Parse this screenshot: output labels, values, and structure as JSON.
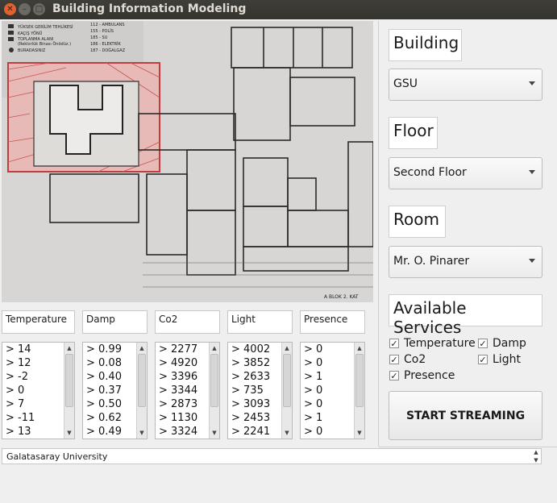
{
  "window": {
    "title": "Building Information Modeling"
  },
  "floorplan": {
    "legend": [
      "YÜKSEK GERİLİM TEHLİKESİ",
      "KAÇIŞ YÖNÜ",
      "TOPLANMA ALANI",
      "(Reklorlük Binası Önödüz.)",
      "BURADASINIZ"
    ],
    "emergency": [
      "112 - AMBULANS",
      "155 - POLİS",
      "185 - SU",
      "186 - ELEKTRİK",
      "187 - DOĞALGAZ"
    ],
    "caption": "A BLOK 2. KAT"
  },
  "sensors": [
    {
      "label": "Temperature",
      "values": [
        "> 14",
        "> 12",
        "> -2",
        "> 0",
        "> 7",
        "> -11",
        "> 13"
      ]
    },
    {
      "label": "Damp",
      "values": [
        "> 0.99",
        "> 0.08",
        "> 0.40",
        "> 0.37",
        "> 0.50",
        "> 0.62",
        "> 0.49"
      ]
    },
    {
      "label": "Co2",
      "values": [
        "> 2277",
        "> 4920",
        "> 3396",
        "> 3344",
        "> 2873",
        "> 1130",
        "> 3324"
      ]
    },
    {
      "label": "Light",
      "values": [
        "> 4002",
        "> 3852",
        "> 2633",
        "> 735",
        "> 3093",
        "> 2453",
        "> 2241"
      ]
    },
    {
      "label": "Presence",
      "values": [
        "> 0",
        "> 0",
        "> 1",
        "> 0",
        "> 0",
        "> 1",
        "> 0"
      ]
    }
  ],
  "panel": {
    "building_label": "Building",
    "building_value": "GSU",
    "floor_label": "Floor",
    "floor_value": "Second Floor",
    "room_label": "Room",
    "room_value": "Mr. O. Pinarer",
    "services_label": "Available Services",
    "services": [
      {
        "label": "Temperature",
        "checked": true
      },
      {
        "label": "Damp",
        "checked": true
      },
      {
        "label": "Co2",
        "checked": true
      },
      {
        "label": "Light",
        "checked": true
      },
      {
        "label": "Presence",
        "checked": true
      }
    ],
    "start_button": "START STREAMING"
  },
  "status": {
    "text": "Galatasaray University"
  }
}
